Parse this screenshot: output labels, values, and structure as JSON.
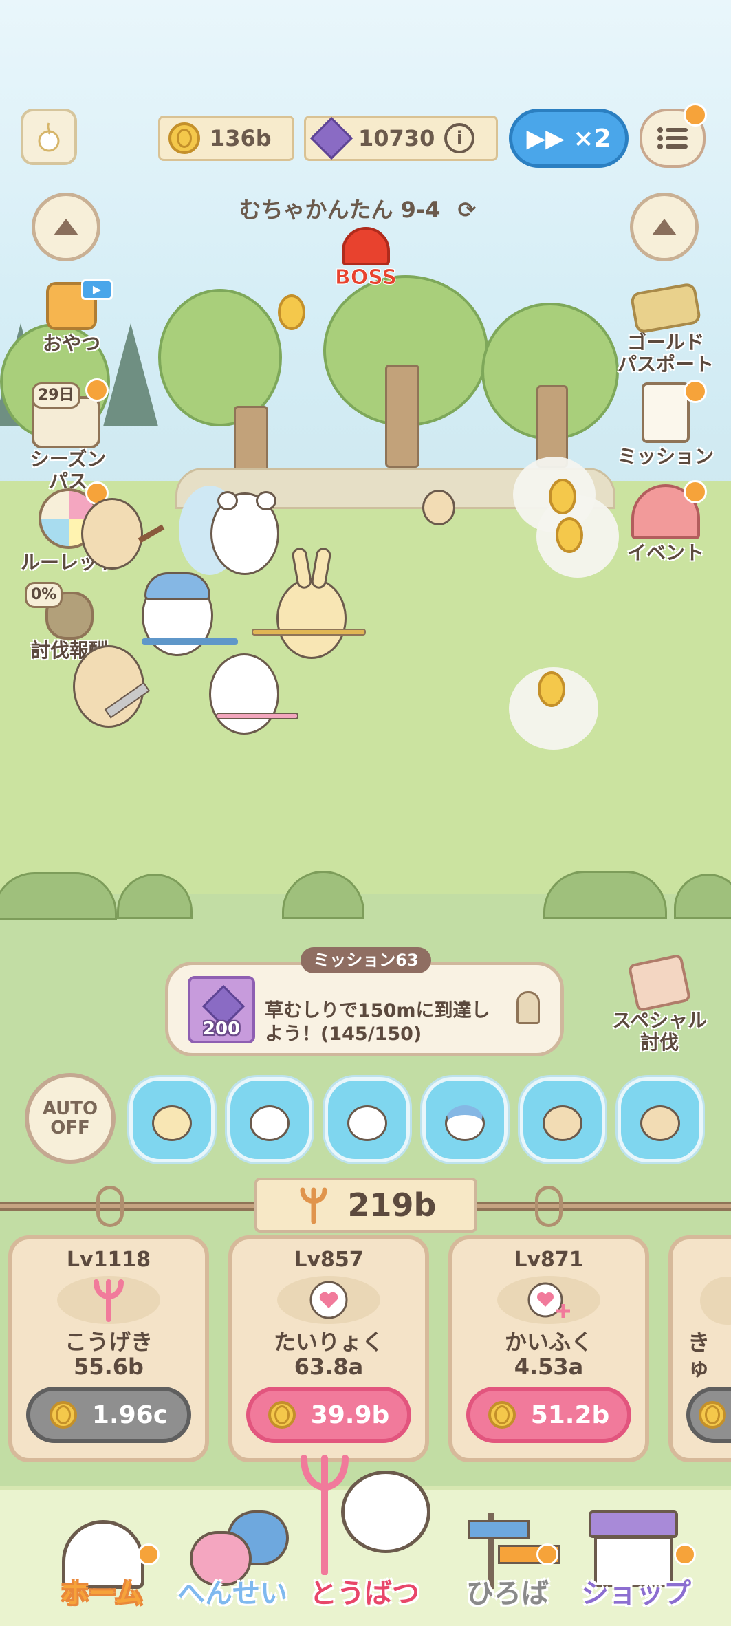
{
  "header": {
    "coins": "136b",
    "gems": "10730",
    "info_icon": "i",
    "speed_label": "▶▶ ×2"
  },
  "stage": {
    "title": "むちゃかんたん 9-4",
    "boss_label": "BOSS"
  },
  "side_left": {
    "snack": "おやつ",
    "season_pass_days": "29日",
    "season_pass": "シーズン\nパス",
    "roulette": "ルーレット",
    "reward_percent": "0%",
    "reward": "討伐報酬"
  },
  "side_right": {
    "gold_passport": "ゴールド\nパスポート",
    "mission": "ミッション",
    "event": "イベント"
  },
  "mission": {
    "title": "ミッション63",
    "reward_count": "200",
    "text": "草むしりで150mに到達しよう！(145/150)"
  },
  "special_hunt": "スペシャル\n討伐",
  "auto": "AUTO\nOFF",
  "gold_total": "219b",
  "upgrades": [
    {
      "level": "Lv1118",
      "name": "こうげき",
      "value": "55.6b",
      "cost": "1.96c",
      "style": "gray",
      "icon": "fork-icon"
    },
    {
      "level": "Lv857",
      "name": "たいりょく",
      "value": "63.8a",
      "cost": "39.9b",
      "style": "pink",
      "icon": "heart-icon"
    },
    {
      "level": "Lv871",
      "name": "かいふく",
      "value": "4.53a",
      "cost": "51.2b",
      "style": "pink",
      "icon": "heal-icon"
    },
    {
      "level": "",
      "name": "きゅ",
      "value": "",
      "cost": "",
      "style": "gray",
      "icon": "unknown"
    }
  ],
  "nav": {
    "home": "ホーム",
    "henshin": "へんせい",
    "toubatsu": "とうばつ",
    "hiroba": "ひろば",
    "shop": "ショップ"
  },
  "colors": {
    "accent_blue": "#4aa6ea",
    "buy_pink": "#f17a9b",
    "notify_orange": "#f6a33a"
  }
}
